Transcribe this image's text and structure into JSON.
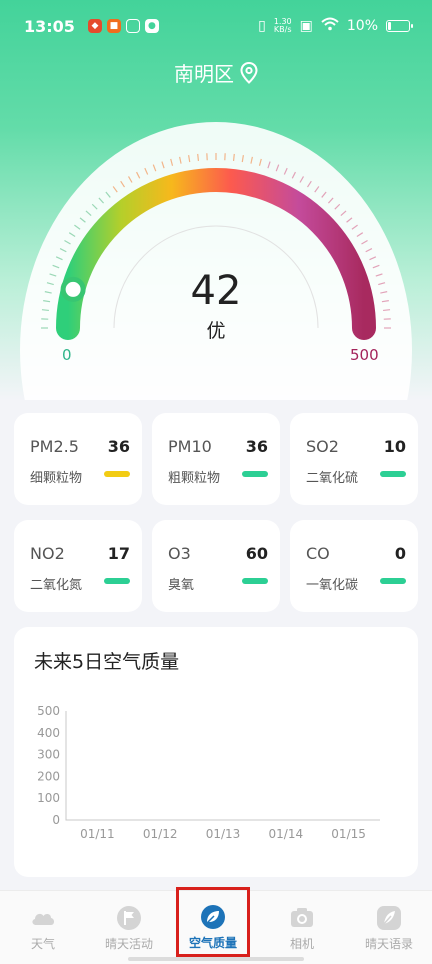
{
  "status": {
    "time": "13:05",
    "net_speed_value": "1.30",
    "net_speed_unit": "KB/s",
    "battery": "10%"
  },
  "location": "南明区",
  "aqi": {
    "value": "42",
    "level": "优",
    "min_label": "0",
    "max_label": "500",
    "value_fraction": 0.084
  },
  "pollutants": [
    {
      "name": "PM2.5",
      "value": "36",
      "cn": "细颗粒物",
      "bar_color": "#f2cc14"
    },
    {
      "name": "PM10",
      "value": "36",
      "cn": "粗颗粒物",
      "bar_color": "#2ccf94"
    },
    {
      "name": "SO2",
      "value": "10",
      "cn": "二氧化硫",
      "bar_color": "#2ccf94"
    },
    {
      "name": "NO2",
      "value": "17",
      "cn": "二氧化氮",
      "bar_color": "#2ccf94"
    },
    {
      "name": "O3",
      "value": "60",
      "cn": "臭氧",
      "bar_color": "#2ccf94"
    },
    {
      "name": "CO",
      "value": "0",
      "cn": "一氧化碳",
      "bar_color": "#2ccf94"
    }
  ],
  "forecast": {
    "title": "未来5日空气质量",
    "chart_data": {
      "type": "line",
      "categories": [
        "01/11",
        "01/12",
        "01/13",
        "01/14",
        "01/15"
      ],
      "y_ticks": [
        "0",
        "100",
        "200",
        "300",
        "400",
        "500"
      ],
      "ylim": [
        0,
        500
      ],
      "series": []
    }
  },
  "tabs": [
    {
      "label": "天气",
      "icon": "cloud-icon",
      "active": false
    },
    {
      "label": "晴天活动",
      "icon": "flag-icon",
      "active": false
    },
    {
      "label": "空气质量",
      "icon": "leaf-drop-icon",
      "active": true
    },
    {
      "label": "相机",
      "icon": "camera-icon",
      "active": false
    },
    {
      "label": "晴天语录",
      "icon": "feather-icon",
      "active": false
    }
  ],
  "colors": {
    "accent_green": "#43d39a",
    "active_tab": "#1d73b8",
    "highlight_border": "#d8201c"
  }
}
